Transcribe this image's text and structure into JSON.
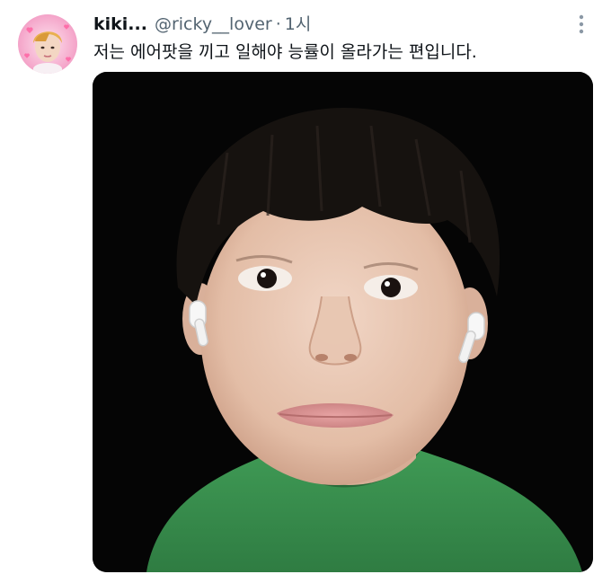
{
  "tweet": {
    "display_name": "kiki...",
    "handle": "@ricky__lover",
    "separator": "·",
    "timestamp": "1시",
    "text": "저는 에어팟을 끼고 일해야 능률이 올라가는 편입니다.",
    "more_icon": "more-vertical-icon"
  },
  "colors": {
    "text_primary": "#0f1419",
    "text_secondary": "#536471",
    "background": "#ffffff",
    "avatar_frame": "#f4a6c8"
  }
}
